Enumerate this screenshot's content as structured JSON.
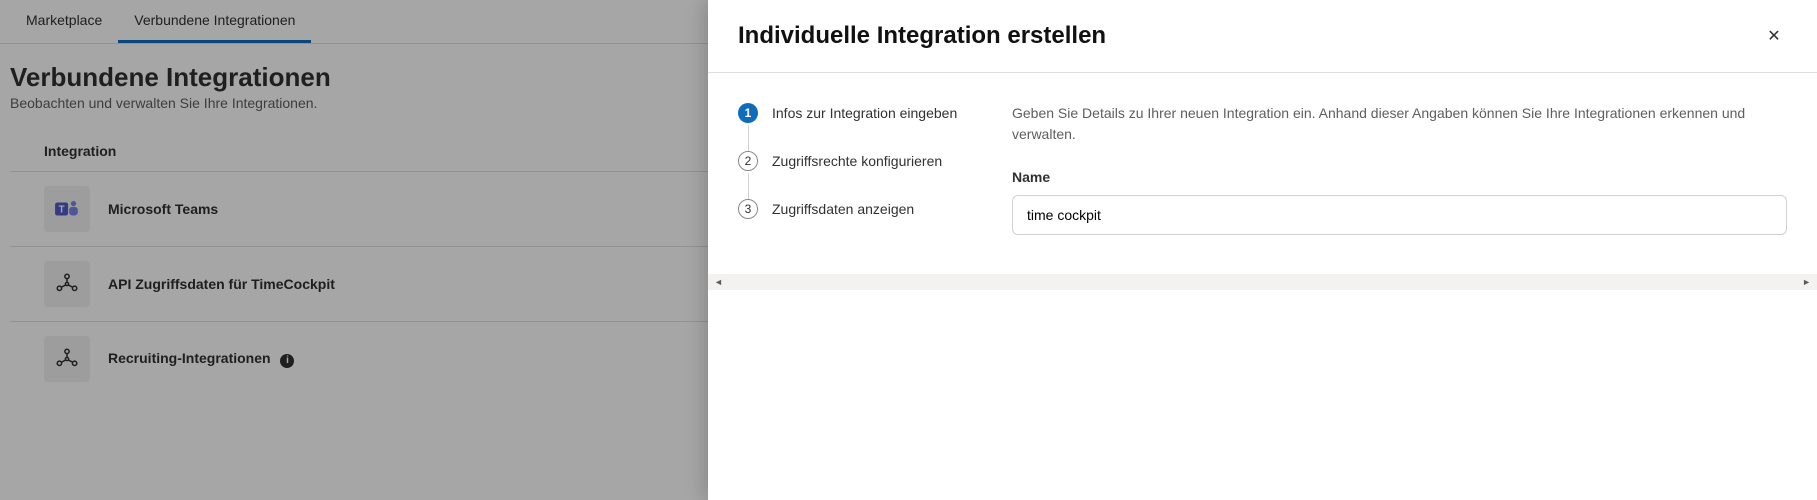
{
  "tabs": {
    "marketplace": "Marketplace",
    "connected": "Verbundene Integrationen"
  },
  "page": {
    "title": "Verbundene Integrationen",
    "subtitle": "Beobachten und verwalten Sie Ihre Integrationen."
  },
  "table": {
    "header": "Integration",
    "rows": [
      {
        "name": "Microsoft Teams"
      },
      {
        "name": "API Zugriffsdaten für TimeCockpit"
      },
      {
        "name": "Recruiting-Integrationen"
      }
    ]
  },
  "panel": {
    "title": "Individuelle Integration erstellen",
    "steps": [
      {
        "num": "1",
        "label": "Infos zur Integration eingeben"
      },
      {
        "num": "2",
        "label": "Zugriffsrechte konfigurieren"
      },
      {
        "num": "3",
        "label": "Zugriffsdaten anzeigen"
      }
    ],
    "description": "Geben Sie Details zu Ihrer neuen Integration ein. Anhand dieser Angaben können Sie Ihre Integrationen erkennen und verwalten.",
    "name_label": "Name",
    "name_value": "time cockpit"
  },
  "icons": {
    "close": "✕",
    "info": "i"
  }
}
